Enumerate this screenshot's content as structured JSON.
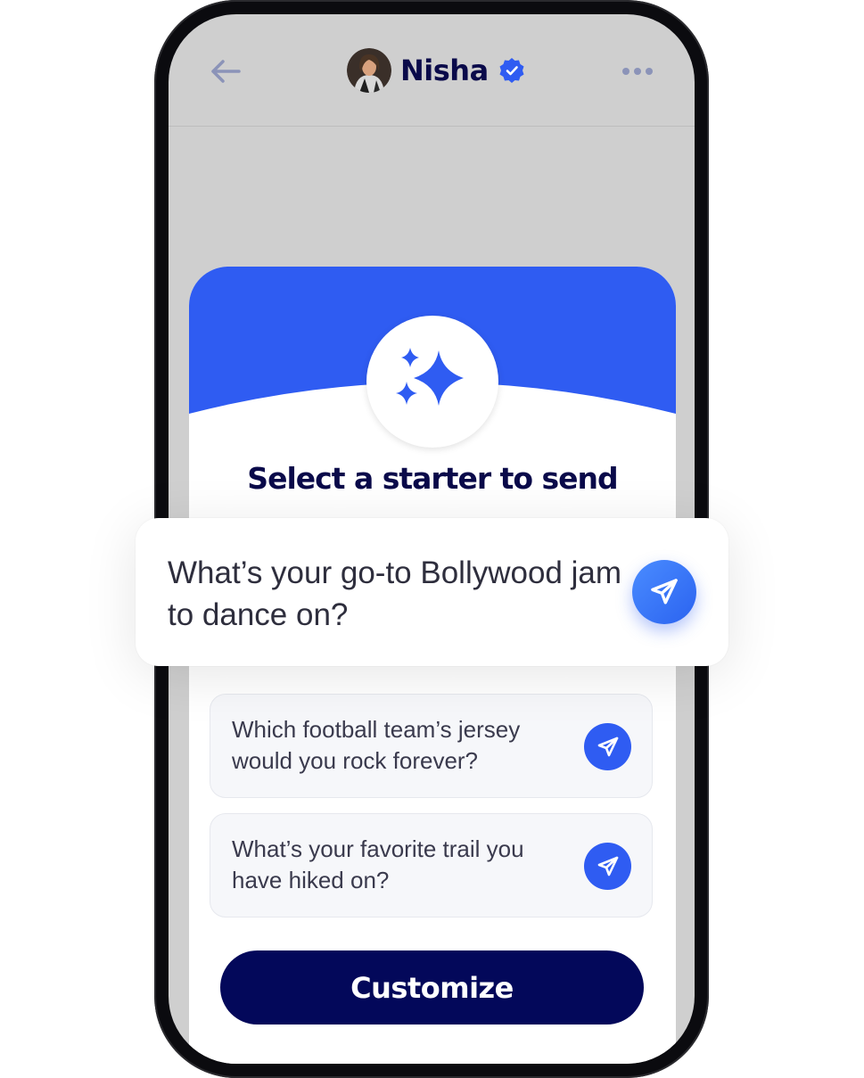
{
  "header": {
    "contact_name": "Nisha",
    "back_icon": "arrow-left-icon",
    "verified_icon": "verified-badge-icon",
    "more_icon": "more-horizontal-icon"
  },
  "card": {
    "icon": "sparkles-icon",
    "title": "Select a starter to send"
  },
  "featured_starter": {
    "text": "What’s your go-to Bollywood jam to dance on?",
    "send_icon": "send-icon"
  },
  "starters": [
    {
      "text": "Which football team’s jersey would you rock forever?",
      "send_icon": "send-icon"
    },
    {
      "text": "What’s your favorite trail you have hiked on?",
      "send_icon": "send-icon"
    }
  ],
  "customize_label": "Customize",
  "colors": {
    "accent": "#2f5cf2",
    "navy": "#03085a",
    "overlay": "#cfcfcf"
  }
}
